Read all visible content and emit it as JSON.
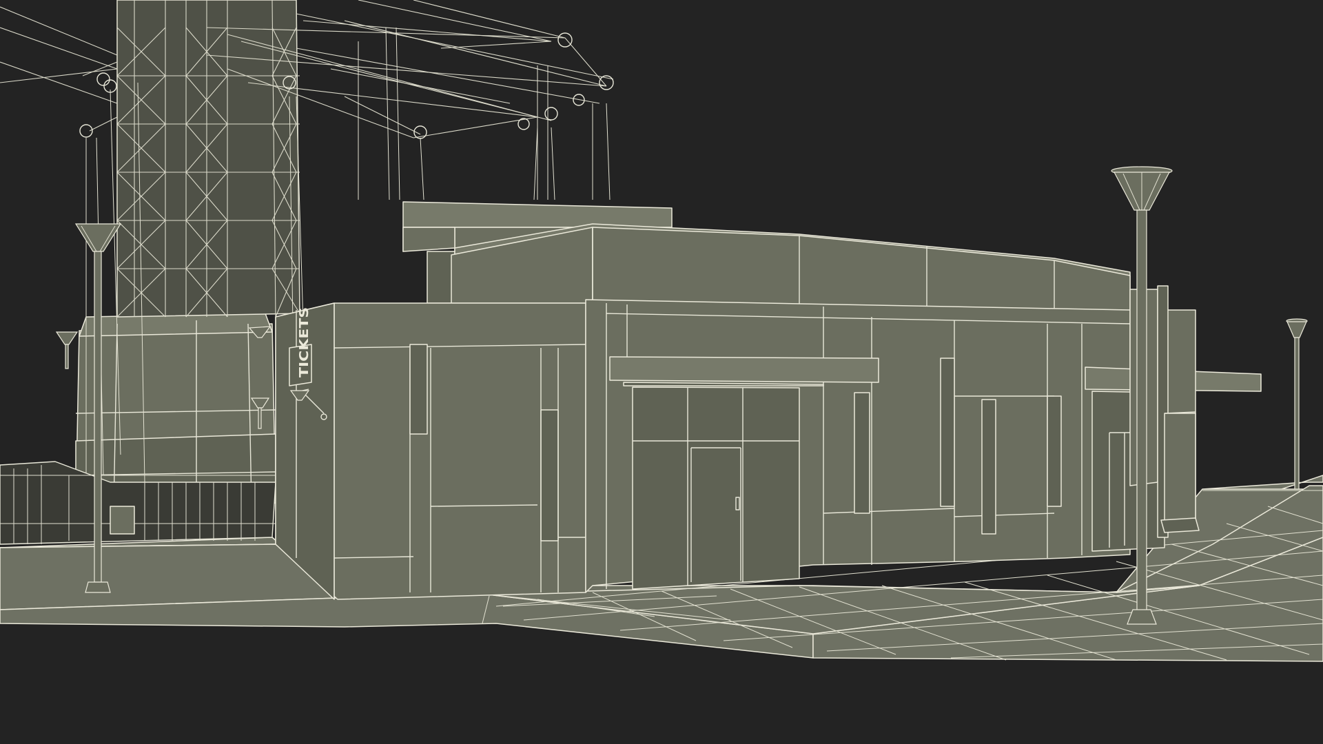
{
  "scene": {
    "background_color": "#232323",
    "wire_color": "#e9e8d9",
    "surface_color": "#6b6e5f",
    "building_sign": "TICKETS"
  }
}
